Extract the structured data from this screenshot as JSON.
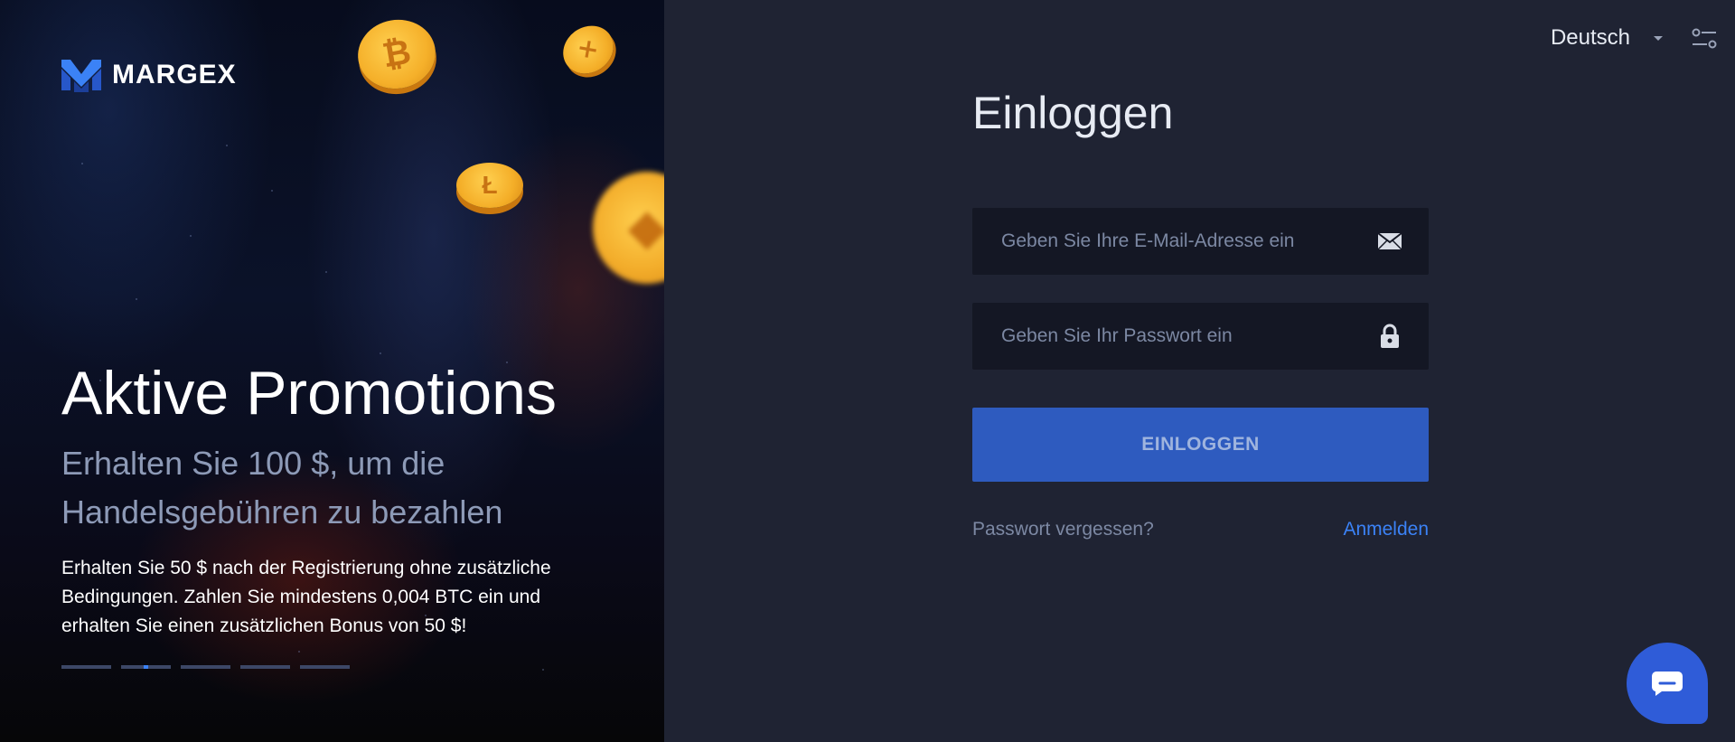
{
  "brand": {
    "name": "MARGEX",
    "logo_icon": "margex-logo-icon"
  },
  "promo": {
    "title": "Aktive Promotions",
    "subtitle": "Erhalten Sie 100 $, um die Handelsgebühren zu bezahlen",
    "text": "Erhalten Sie 50 $ nach der Registrierung ohne zusätzliche Bedingungen. Zahlen Sie mindestens 0,004 BTC ein und erhalten Sie einen zusätzlichen Bonus von 50 $!",
    "slide_count": 5,
    "active_slide": 2
  },
  "header": {
    "language": "Deutsch",
    "settings_icon": "sliders-icon"
  },
  "login": {
    "title": "Einloggen",
    "email_placeholder": "Geben Sie Ihre E-Mail-Adresse ein",
    "email_value": "",
    "password_placeholder": "Geben Sie Ihr Passwort ein",
    "password_value": "",
    "submit_label": "EINLOGGEN",
    "forgot_label": "Passwort vergessen?",
    "register_label": "Anmelden"
  },
  "colors": {
    "accent": "#2e5bbf",
    "link": "#3b82f6",
    "panel_bg": "#1f2333",
    "field_bg": "#141724"
  }
}
